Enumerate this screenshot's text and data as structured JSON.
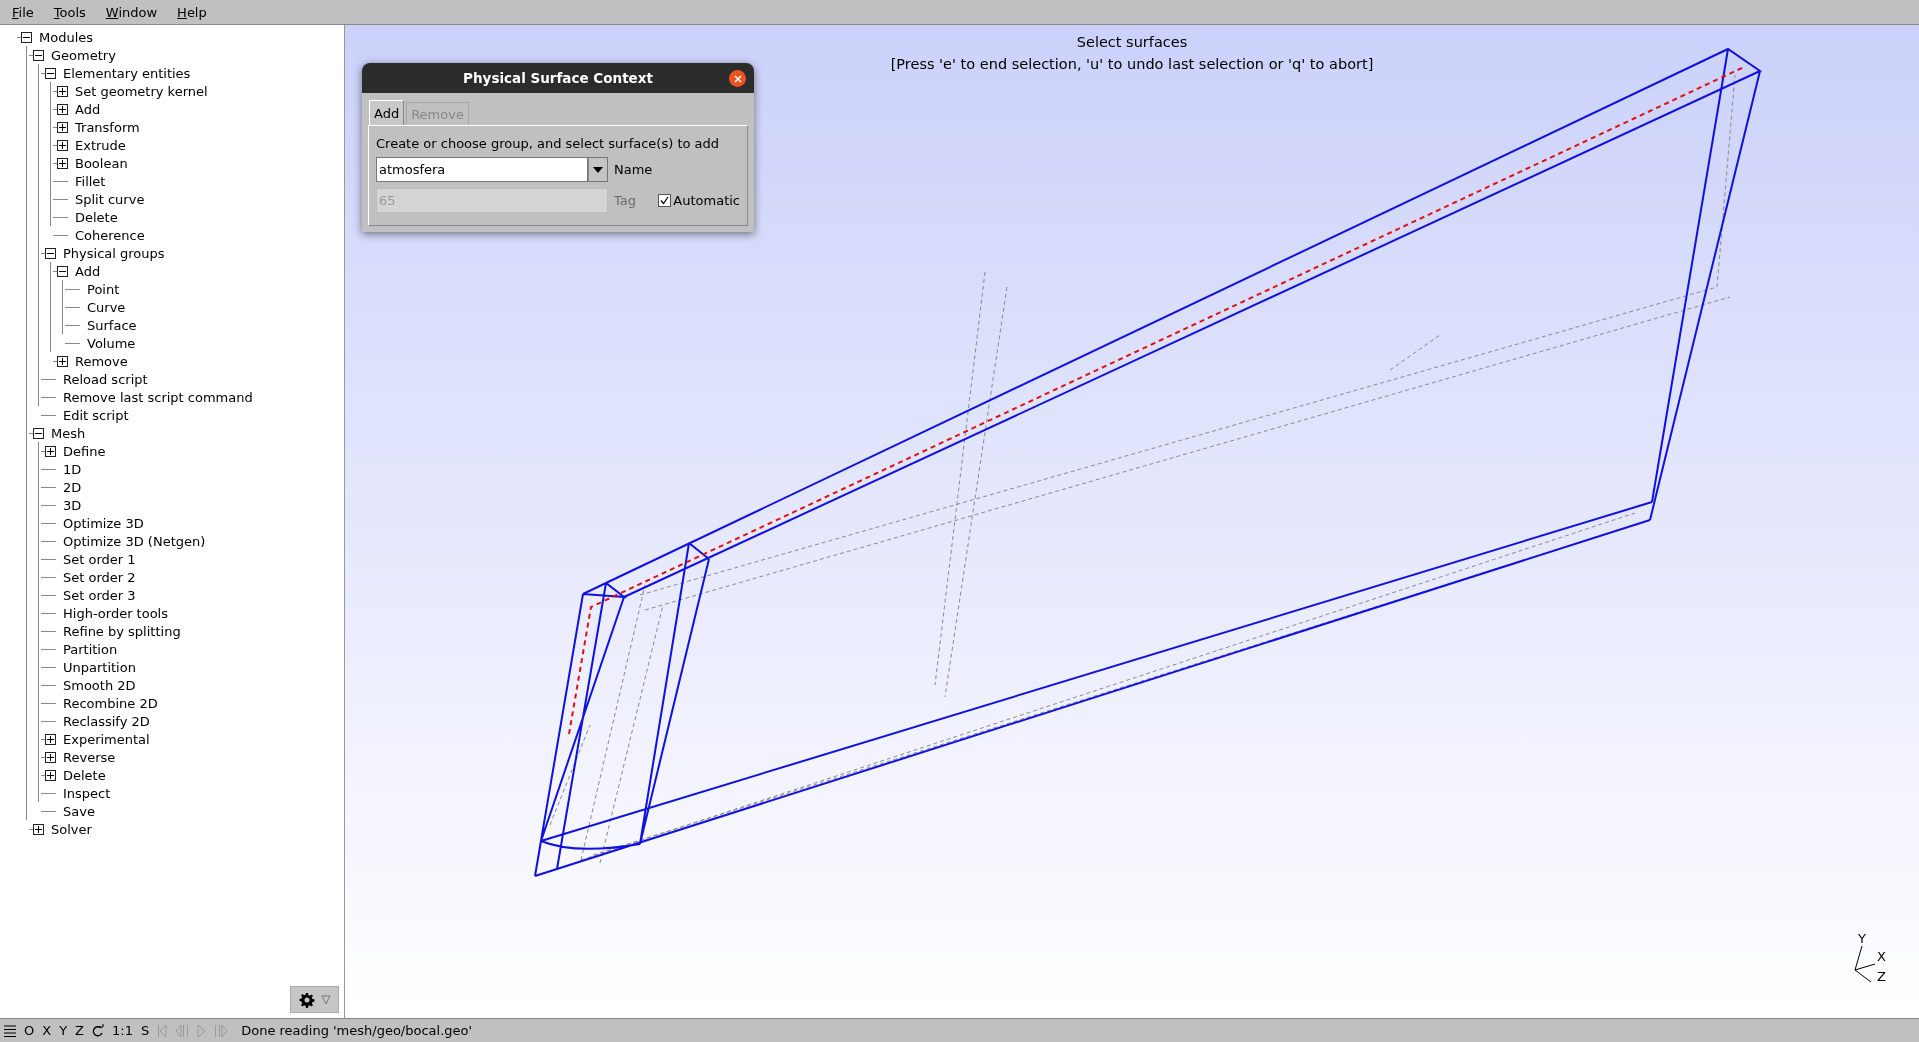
{
  "menu": [
    "File",
    "Tools",
    "Window",
    "Help"
  ],
  "tree": [
    {
      "label": "Modules",
      "expanded": true,
      "children": [
        {
          "label": "Geometry",
          "expanded": true,
          "children": [
            {
              "label": "Elementary entities",
              "expanded": true,
              "children": [
                {
                  "label": "Set geometry kernel",
                  "expanded": false
                },
                {
                  "label": "Add",
                  "expanded": false
                },
                {
                  "label": "Transform",
                  "expanded": false
                },
                {
                  "label": "Extrude",
                  "expanded": false
                },
                {
                  "label": "Boolean",
                  "expanded": false
                },
                {
                  "label": "Fillet"
                },
                {
                  "label": "Split curve"
                },
                {
                  "label": "Delete"
                },
                {
                  "label": "Coherence"
                }
              ]
            },
            {
              "label": "Physical groups",
              "expanded": true,
              "children": [
                {
                  "label": "Add",
                  "expanded": true,
                  "children": [
                    {
                      "label": "Point"
                    },
                    {
                      "label": "Curve"
                    },
                    {
                      "label": "Surface"
                    },
                    {
                      "label": "Volume"
                    }
                  ]
                },
                {
                  "label": "Remove",
                  "expanded": false
                }
              ]
            },
            {
              "label": "Reload script"
            },
            {
              "label": "Remove last script command"
            },
            {
              "label": "Edit script"
            }
          ]
        },
        {
          "label": "Mesh",
          "expanded": true,
          "children": [
            {
              "label": "Define",
              "expanded": false
            },
            {
              "label": "1D"
            },
            {
              "label": "2D"
            },
            {
              "label": "3D"
            },
            {
              "label": "Optimize 3D"
            },
            {
              "label": "Optimize 3D (Netgen)"
            },
            {
              "label": "Set order 1"
            },
            {
              "label": "Set order 2"
            },
            {
              "label": "Set order 3"
            },
            {
              "label": "High-order tools"
            },
            {
              "label": "Refine by splitting"
            },
            {
              "label": "Partition"
            },
            {
              "label": "Unpartition"
            },
            {
              "label": "Smooth 2D"
            },
            {
              "label": "Recombine 2D"
            },
            {
              "label": "Reclassify 2D"
            },
            {
              "label": "Experimental",
              "expanded": false
            },
            {
              "label": "Reverse",
              "expanded": false
            },
            {
              "label": "Delete",
              "expanded": false
            },
            {
              "label": "Inspect"
            },
            {
              "label": "Save"
            }
          ]
        },
        {
          "label": "Solver",
          "expanded": false
        }
      ]
    }
  ],
  "viewport": {
    "prompt": "Select surfaces",
    "hint": "[Press 'e' to end selection, 'u' to undo last selection or 'q' to abort]",
    "axes": [
      "Y",
      "X",
      "Z"
    ]
  },
  "dialog": {
    "title": "Physical Surface Context",
    "tabs": [
      {
        "label": "Add",
        "selected": true
      },
      {
        "label": "Remove",
        "selected": false
      }
    ],
    "instruction": "Create or choose group, and select surface(s) to add",
    "name_field": {
      "value": "atmosfera",
      "label": "Name"
    },
    "tag_field": {
      "value": "65",
      "label": "Tag",
      "disabled": true
    },
    "automatic": {
      "label": "Automatic",
      "checked": true
    }
  },
  "status_bar": {
    "view_buttons": [
      "O",
      "X",
      "Y",
      "Z"
    ],
    "scale": "1:1",
    "s_button": "S",
    "message": "Done reading 'mesh/geo/bocal.geo'"
  }
}
